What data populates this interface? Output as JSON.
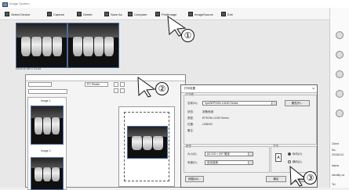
{
  "window": {
    "title": "Image System"
  },
  "toolbar": [
    {
      "label": "Select Device",
      "icon": "select-device-icon"
    },
    {
      "label": "Capture",
      "icon": "capture-icon"
    },
    {
      "label": "Delete",
      "icon": "delete-icon"
    },
    {
      "label": "Save As",
      "icon": "save-as-icon"
    },
    {
      "label": "Compare",
      "icon": "compare-icon"
    },
    {
      "label": "PrintImage",
      "icon": "print-image-icon"
    },
    {
      "label": "ImageSource",
      "icon": "image-source-icon"
    },
    {
      "label": "Exit",
      "icon": "exit-icon"
    }
  ],
  "thumbnail_timestamp": "2018-11-08 17:11:33",
  "print_window": {
    "printer_select": "PC Printer",
    "image_labels": [
      "Image 1",
      "Image 2"
    ]
  },
  "print_dialog": {
    "title": "打印设置",
    "printer_group": "打印机",
    "name_label": "名称(N):",
    "name_value": "\\\\pc0\\EPSON L4150 Series",
    "properties_button": "属性(P)...",
    "status_label": "状态:",
    "status_value": "准备就绪",
    "type_label": "类型:",
    "type_value": "EPSON L4150 Series",
    "where_label": "位置:",
    "where_value": "USB002",
    "comment_label": "备注:",
    "paper_group": "纸张",
    "size_label": "大小(Z):",
    "size_value": "A4 210 × 297 毫米",
    "source_label": "来源(S):",
    "source_value": "自动选择",
    "orientation_group": "方向",
    "portrait_label": "纵向(O)",
    "landscape_label": "横向(A)",
    "network_button": "网络(W)...",
    "ok_button": "确定",
    "cancel_button": "取消"
  },
  "right_panel": {
    "client_label": "Client",
    "no_label": "No.",
    "no_value": "20181113",
    "name_label": "Name",
    "name_value": "",
    "identity_label": "Identity ca",
    "tel_label": "Tel"
  },
  "callouts": [
    "①",
    "②",
    "③"
  ]
}
